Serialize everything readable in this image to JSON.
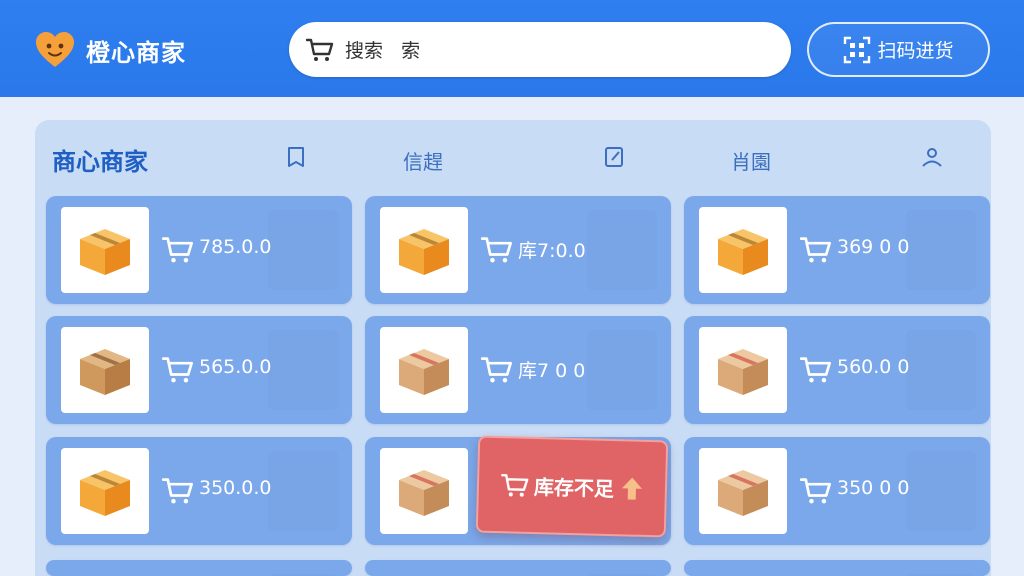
{
  "header": {
    "brand_name": "橙心商家",
    "search_text": "搜索   索",
    "scan_button": "扫码进货"
  },
  "nav": {
    "title": "商心商家",
    "items": [
      {
        "label": "信趕",
        "icon": "book-icon"
      },
      {
        "label": "肖園",
        "icon": "note-icon"
      }
    ],
    "user_icon": "person-icon"
  },
  "products": [
    {
      "value": "785.0.0",
      "box": "orange"
    },
    {
      "value": "库7:0.0",
      "box": "orange"
    },
    {
      "value": "369 0 0",
      "box": "orange"
    },
    {
      "value": "565.0.0",
      "box": "brown"
    },
    {
      "value": "库7 0 0",
      "box": "tan"
    },
    {
      "value": "560.0 0",
      "box": "tan"
    },
    {
      "value": "350.0.0",
      "box": "orange"
    },
    {
      "value": "",
      "box": "tan"
    },
    {
      "value": "350 0 0",
      "box": "tan"
    }
  ],
  "toast": {
    "message": "库存不足"
  },
  "colors": {
    "header_blue": "#2f7ff0",
    "card_blue": "#7aa8ea",
    "toast_red": "#e06466",
    "box_orange": "#f0a030",
    "box_tan": "#d9ad7c"
  }
}
